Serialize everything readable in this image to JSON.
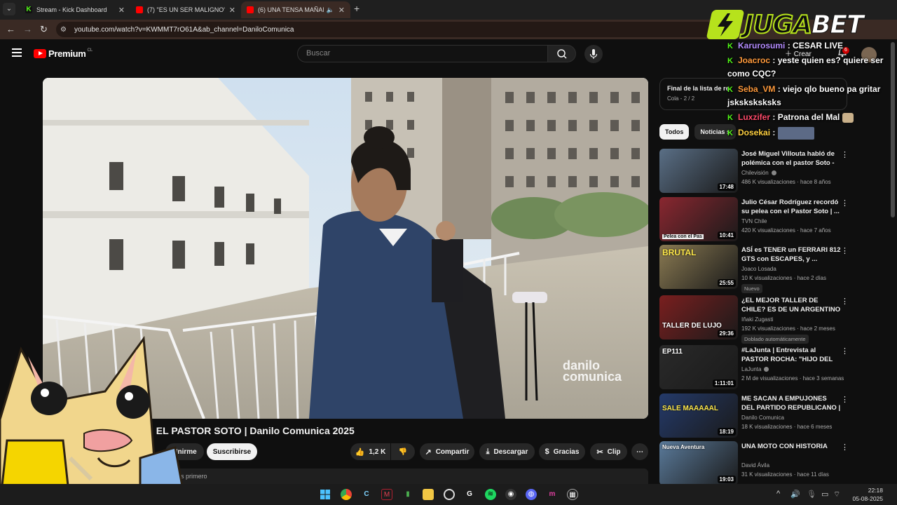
{
  "browser": {
    "tabs": [
      {
        "title": "Stream - Kick Dashboard",
        "favicon": "kick-icon"
      },
      {
        "title": "(7) \"ES UN SER MALIGNO\": Villo",
        "favicon": "youtube-icon"
      },
      {
        "title": "(6) UNA TENSA MAÑANA C",
        "favicon": "youtube-icon"
      }
    ],
    "url": "youtube.com/watch?v=KWMMT7rO61A&ab_channel=DaniloComunica"
  },
  "youtube": {
    "logo_text": "Premium",
    "country": "CL",
    "search_placeholder": "Buscar",
    "create_label": "Crear",
    "notifications_count": "6"
  },
  "video": {
    "watermark_line1": "danilo",
    "watermark_line2": "comunica",
    "title": "| EL PASTOR SOTO | Danilo Comunica 2025",
    "subscriber_fragment": "3",
    "join_label": "Unirme",
    "subscribe_label": "Suscribirse",
    "likes": "1,2 K",
    "share_label": "Compartir",
    "download_label": "Descargar",
    "thanks_label": "Gracias",
    "clip_label": "Clip",
    "comments_sort": "ros primero"
  },
  "queue": {
    "title": "Final de la lista de re",
    "subtitle": "Cola - 2 / 2"
  },
  "chips": [
    {
      "label": "Todos",
      "active": true
    },
    {
      "label": "Noticias s",
      "active": false
    }
  ],
  "recommendations": [
    {
      "title": "José Miguel Villouta habló de polémica con el pastor Soto - ...",
      "channel": "Chilevisión",
      "verified": true,
      "views": "486 K visualizaciones · hace 8 años",
      "duration": "17:48",
      "overlay": "",
      "tag": "",
      "color": "#5a6f86"
    },
    {
      "title": "Julio César Rodríguez recordó su pelea con el Pastor Soto | ...",
      "channel": "TVN Chile",
      "verified": false,
      "views": "420 K visualizaciones · hace 7 años",
      "duration": "10:41",
      "overlay": "Pelea con el Pas",
      "tag": "",
      "color": "#8a2730"
    },
    {
      "title": "ASÍ es TENER un FERRARI 812 GTS con ESCAPES, y ...",
      "channel": "Joaco Losada",
      "verified": false,
      "views": "10 K visualizaciones · hace 2 días",
      "duration": "25:55",
      "overlay": "BRUTAL",
      "tag": "Nuevo",
      "color": "#8a7a52"
    },
    {
      "title": "¿EL MEJOR TALLER DE CHILE? ES DE UN ARGENTINO Y SOLO...",
      "channel": "Iñaki Zugasti",
      "verified": false,
      "views": "192 K visualizaciones · hace 2 meses",
      "duration": "29:36",
      "overlay": "TALLER DE LUJO",
      "tag": "Doblado automáticamente",
      "color": "#7a1f1f"
    },
    {
      "title": "#LaJunta | Entrevista al PASTOR ROCHA: \"HIJO DEL J...",
      "channel": "LaJunta",
      "verified": true,
      "views": "2 M de visualizaciones · hace 3 semanas",
      "duration": "1:11:01",
      "overlay": "EP111",
      "tag": "",
      "color": "#2a2a2a"
    },
    {
      "title": "ME SACAN A EMPUJONES DEL PARTIDO REPUBLICANO | ...",
      "channel": "Danilo Comunica",
      "verified": false,
      "views": "18 K visualizaciones · hace 6 meses",
      "duration": "18:19",
      "overlay": "SALE MAAAAAL",
      "tag": "",
      "color": "#243a6a"
    },
    {
      "title": "UNA MOTO CON HISTORIA",
      "channel": "David Ávila",
      "verified": false,
      "views": "31 K visualizaciones · hace 11 días",
      "duration": "19:03",
      "overlay": "Nueva Aventura",
      "tag": "",
      "color": "#5a7a9a"
    }
  ],
  "overlay": {
    "brand_part1": "JUGA",
    "brand_part2": "BET",
    "brand_color": "#b6e21c",
    "chat": [
      {
        "user": "Karurosumi",
        "color": "#b48cff",
        "text": "CESAR LIVE"
      },
      {
        "user": "Joacroc",
        "color": "#ff9a3c",
        "text": "yeste quien es? quiere ser como CQC?"
      },
      {
        "user": "Seba_VM",
        "color": "#ff9a3c",
        "text": "viejo qlo bueno pa gritar jsksksksksks"
      },
      {
        "user": "Luxzifer",
        "color": "#ff4a6a",
        "text": "Patrona del Mal"
      },
      {
        "user": "Dosekai",
        "color": "#ffd040",
        "text": ""
      }
    ]
  },
  "taskbar": {
    "time": "22:18",
    "date": "05-08-2025"
  }
}
